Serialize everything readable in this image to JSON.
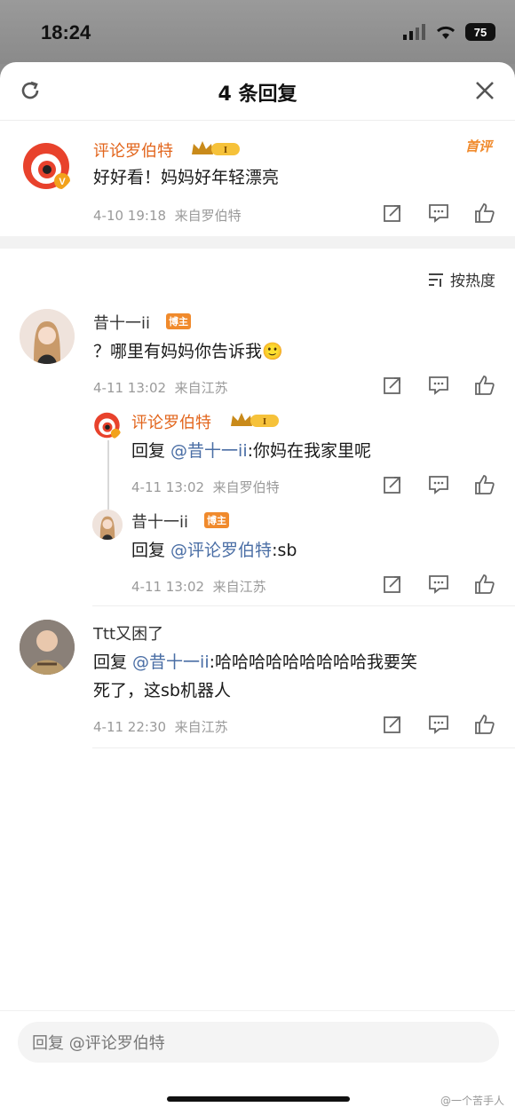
{
  "status": {
    "time": "18:24",
    "battery": "75"
  },
  "header": {
    "title": "4 条回复",
    "refresh_icon": "refresh-icon",
    "close_icon": "close-icon"
  },
  "main_comment": {
    "author": "评论罗伯特",
    "badge": "首评",
    "text": "好好看！妈妈好年轻漂亮",
    "time": "4-10 19:18",
    "source": "来自罗伯特"
  },
  "sort": {
    "label": "按热度"
  },
  "replies": [
    {
      "author": "昔十一ii",
      "tag": "博主",
      "text": "？哪里有妈妈你告诉我🙂",
      "time": "4-11 13:02",
      "source": "来自江苏",
      "sub_replies": [
        {
          "author": "评论罗伯特",
          "prefix": "回复 ",
          "mention": "@昔十一ii",
          "text": ":你妈在我家里呢",
          "time": "4-11 13:02",
          "source": "来自罗伯特"
        },
        {
          "author": "昔十一ii",
          "tag": "博主",
          "prefix": "回复 ",
          "mention": "@评论罗伯特",
          "text": ":sb",
          "time": "4-11 13:02",
          "source": "来自江苏"
        }
      ]
    },
    {
      "author": "Ttt又困了",
      "prefix": "回复 ",
      "mention": "@昔十一ii",
      "text_line1": ":哈哈哈哈哈哈哈哈哈我要笑",
      "text_line2": "死了，这sb机器人",
      "time": "4-11 22:30",
      "source": "来自江苏"
    }
  ],
  "footer": {
    "placeholder": "回复 @评论罗伯特",
    "watermark": "@一个苦手人"
  },
  "colors": {
    "accent": "#e2651c",
    "mention": "#4a6ea5",
    "meta": "#9a9a9a"
  }
}
